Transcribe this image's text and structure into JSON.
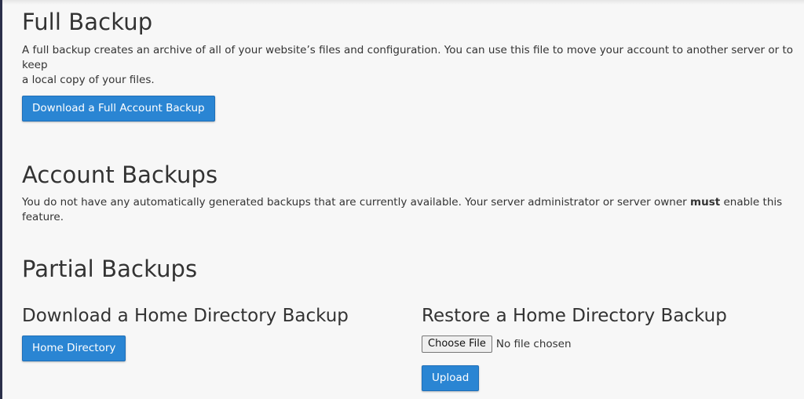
{
  "full_backup": {
    "title": "Full Backup",
    "description_line1": "A full backup creates an archive of all of your website’s files and configuration. You can use this file to move your account to another server or to keep",
    "description_line2": "a local copy of your files.",
    "button_label": "Download a Full Account Backup"
  },
  "account_backups": {
    "title": "Account Backups",
    "description_before_bold": "You do not have any automatically generated backups that are currently available. Your server administrator or server owner ",
    "description_bold": "must",
    "description_after_bold": " enable this",
    "description_line2": "feature."
  },
  "partial_backups": {
    "title": "Partial Backups",
    "home_download": {
      "title": "Download a Home Directory Backup",
      "button_label": "Home Directory"
    },
    "home_restore": {
      "title": "Restore a Home Directory Backup",
      "choose_file_label": "Choose File",
      "file_status": "No file chosen",
      "upload_label": "Upload"
    }
  },
  "colors": {
    "accent": "#2a85d3",
    "background": "#f7f7f7",
    "text": "#333333",
    "left_rail": "#2b2f4a"
  }
}
